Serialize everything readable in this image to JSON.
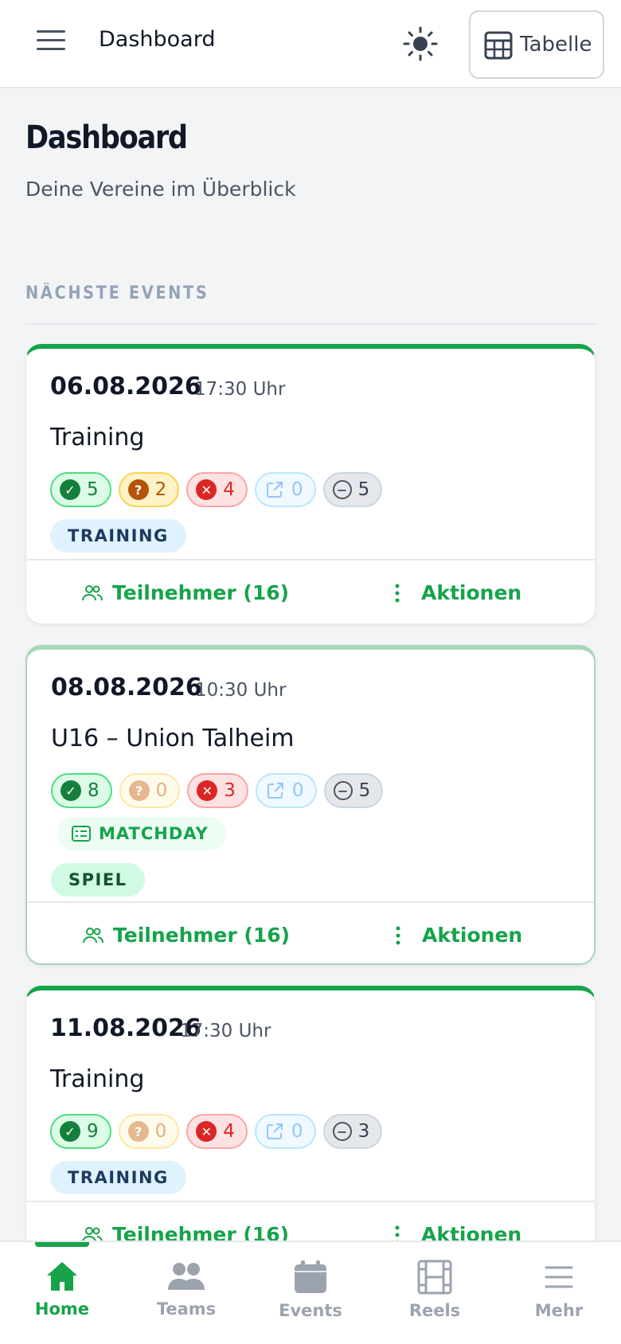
{
  "header": {
    "title": "Dashboard",
    "table_button": "Tabelle"
  },
  "page": {
    "title": "Dashboard",
    "subtitle": "Deine Vereine im Überblick",
    "section": "NÄCHSTE EVENTS"
  },
  "events": [
    {
      "date": "06.08.2026",
      "time": "17:30 Uhr",
      "title": "Training",
      "counts": {
        "yes": "5",
        "maybe": "2",
        "no": "4",
        "external": "0",
        "none": "5"
      },
      "tag": "TRAINING",
      "participants": "Teilnehmer (16)",
      "actions": "Aktionen"
    },
    {
      "date": "08.08.2026",
      "time": "10:30 Uhr",
      "title": "U16 – Union Talheim",
      "counts": {
        "yes": "8",
        "maybe": "0",
        "no": "3",
        "external": "0",
        "none": "5"
      },
      "matchday": "MATCHDAY",
      "tag": "SPIEL",
      "participants": "Teilnehmer (16)",
      "actions": "Aktionen"
    },
    {
      "date": "11.08.2026",
      "time": "17:30 Uhr",
      "title": "Training",
      "counts": {
        "yes": "9",
        "maybe": "0",
        "no": "4",
        "external": "0",
        "none": "3"
      },
      "tag": "TRAINING",
      "participants": "Teilnehmer (16)",
      "actions": "Aktionen"
    }
  ],
  "nav": {
    "home": "Home",
    "teams": "Teams",
    "events": "Events",
    "reels": "Reels",
    "more": "Mehr"
  },
  "colors": {
    "accent": "#16a34a",
    "yes": "#15803d",
    "maybe": "#b45309",
    "no": "#dc2626"
  }
}
